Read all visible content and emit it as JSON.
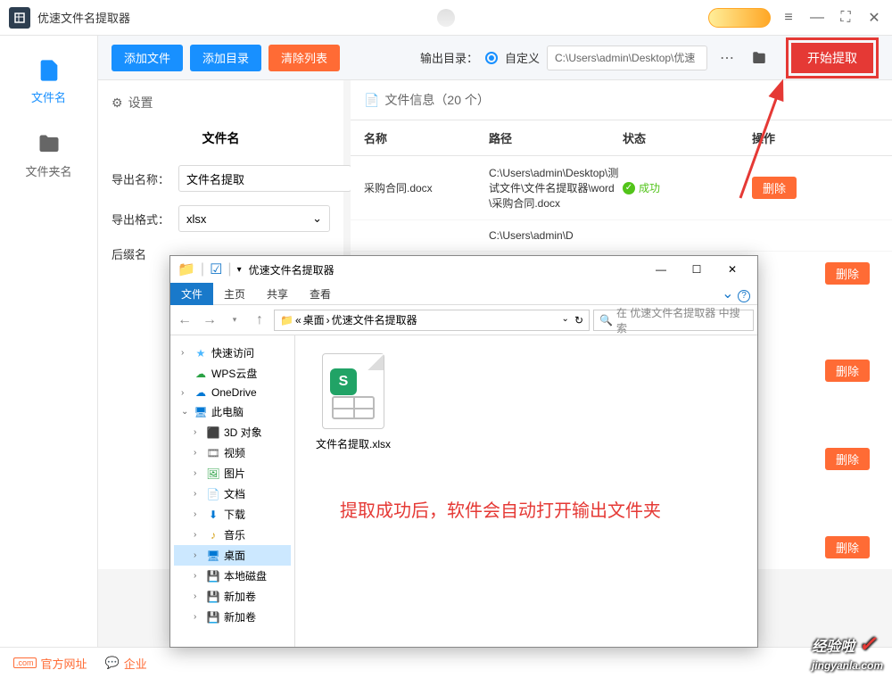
{
  "titlebar": {
    "title": "优速文件名提取器"
  },
  "toolbar": {
    "add_file": "添加文件",
    "add_folder": "添加目录",
    "clear_list": "清除列表",
    "output_dir_label": "输出目录：",
    "custom_label": "自定义",
    "path_value": "C:\\Users\\admin\\Desktop\\优速",
    "start_extract": "开始提取"
  },
  "sidebar": {
    "items": [
      {
        "label": "文件名",
        "active": true
      },
      {
        "label": "文件夹名",
        "active": false
      }
    ]
  },
  "settings": {
    "header": "设置",
    "title": "文件名",
    "export_name_label": "导出名称：",
    "export_name_value": "文件名提取",
    "export_format_label": "导出格式：",
    "export_format_value": "xlsx",
    "suffix_label": "后缀名"
  },
  "file_panel": {
    "header": "文件信息（20 个）",
    "columns": {
      "name": "名称",
      "path": "路径",
      "status": "状态",
      "action": "操作"
    },
    "rows": [
      {
        "name": "采购合同.docx",
        "path": "C:\\Users\\admin\\Desktop\\测试文件\\文件名提取器\\word\\采购合同.docx",
        "status": "成功",
        "action": "删除"
      }
    ],
    "path_partial": "C:\\Users\\admin\\D",
    "delete_label": "删除"
  },
  "explorer": {
    "title": "优速文件名提取器",
    "ribbon": {
      "file": "文件",
      "home": "主页",
      "share": "共享",
      "view": "查看"
    },
    "breadcrumb": {
      "part1": "桌面",
      "part2": "优速文件名提取器"
    },
    "search_placeholder": "在 优速文件名提取器 中搜索",
    "tree": [
      {
        "label": "快速访问",
        "icon": "star",
        "indent": 0,
        "chev": ">"
      },
      {
        "label": "WPS云盘",
        "icon": "cloud-green",
        "indent": 0,
        "chev": ""
      },
      {
        "label": "OneDrive",
        "icon": "cloud-blue",
        "indent": 0,
        "chev": ">"
      },
      {
        "label": "此电脑",
        "icon": "pc",
        "indent": 0,
        "chev": "v"
      },
      {
        "label": "3D 对象",
        "icon": "3d",
        "indent": 1,
        "chev": ">"
      },
      {
        "label": "视频",
        "icon": "video",
        "indent": 1,
        "chev": ">"
      },
      {
        "label": "图片",
        "icon": "image",
        "indent": 1,
        "chev": ">"
      },
      {
        "label": "文档",
        "icon": "doc",
        "indent": 1,
        "chev": ">"
      },
      {
        "label": "下载",
        "icon": "download",
        "indent": 1,
        "chev": ">"
      },
      {
        "label": "音乐",
        "icon": "music",
        "indent": 1,
        "chev": ">"
      },
      {
        "label": "桌面",
        "icon": "desktop",
        "indent": 1,
        "chev": ">",
        "selected": true
      },
      {
        "label": "本地磁盘",
        "icon": "disk",
        "indent": 1,
        "chev": ">"
      },
      {
        "label": "新加卷",
        "icon": "disk",
        "indent": 1,
        "chev": ">"
      },
      {
        "label": "新加卷",
        "icon": "disk",
        "indent": 1,
        "chev": ">"
      }
    ],
    "file": {
      "name": "文件名提取.xlsx",
      "badge": "S"
    },
    "annotation": "提取成功后，软件会自动打开输出文件夹"
  },
  "footer": {
    "official": "官方网址",
    "enterprise": "企业"
  },
  "watermark": {
    "text": "经验啦",
    "url": "jingyanla.com"
  }
}
